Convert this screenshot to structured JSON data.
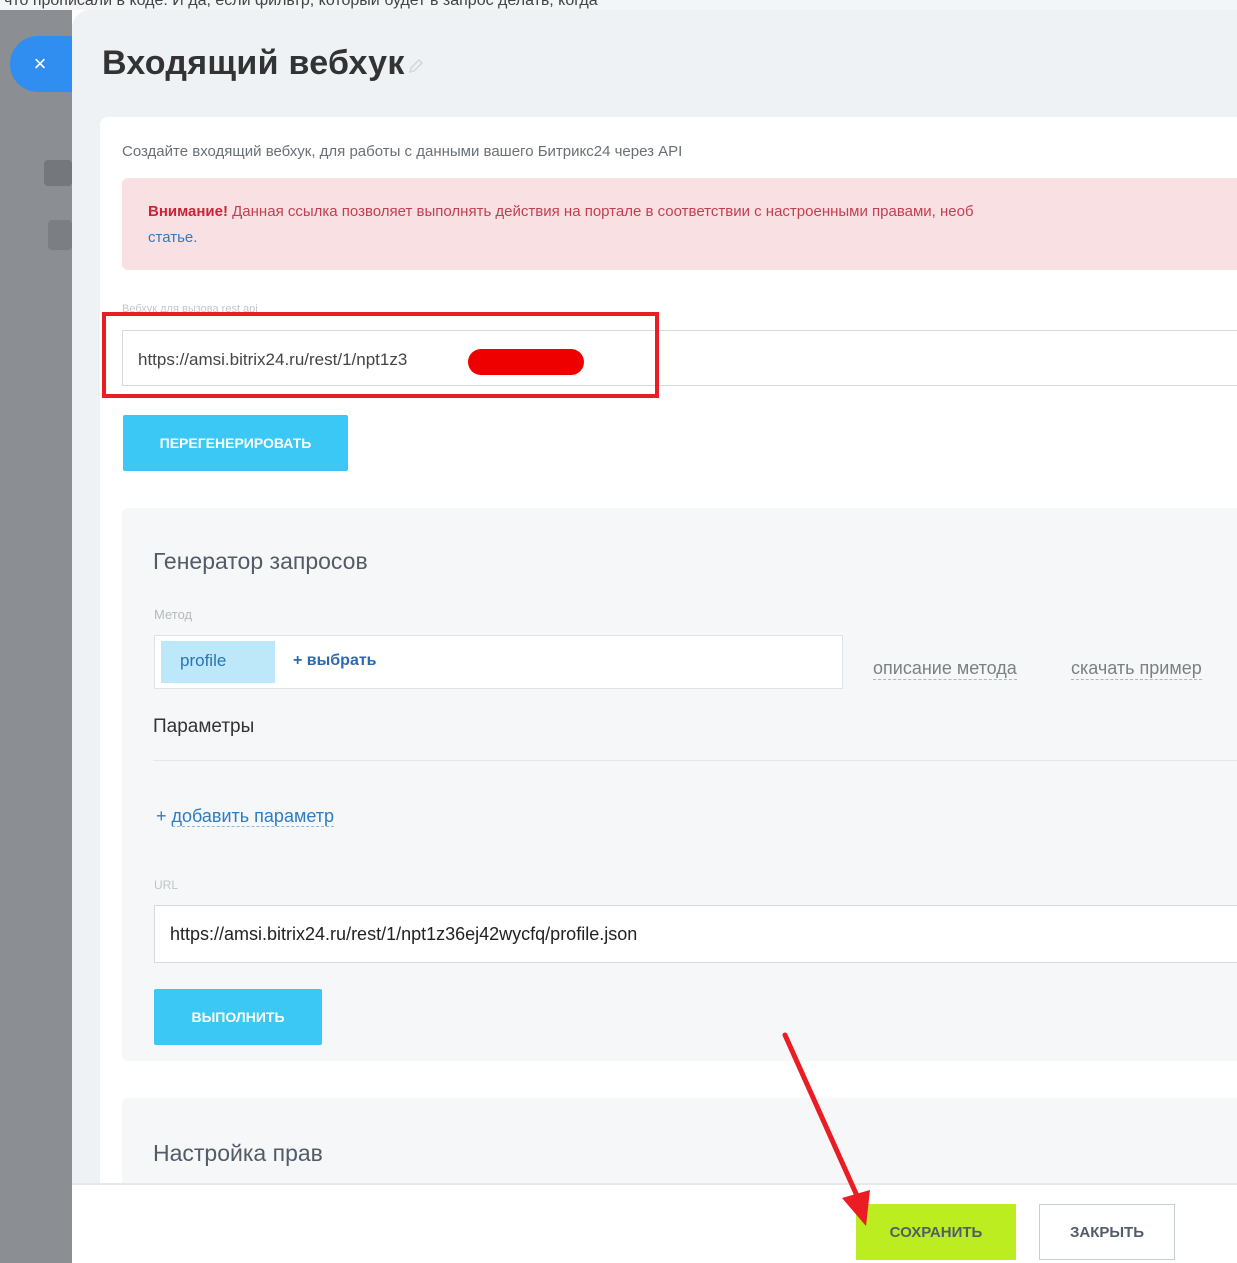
{
  "window": {
    "close_icon": "×",
    "title": "Входящий вебхук",
    "partial_top_text": "что прописали в коде. И да, если фильтр, который будет в запрос делать, когда"
  },
  "intro": {
    "text": "Создайте входящий вебхук, для работы с данными вашего Битрикс24 через API"
  },
  "alert": {
    "strong": "Внимание!",
    "text": " Данная ссылка позволяет выполнять действия на портале в соответствии с настроенными правами, необ",
    "link": "статье."
  },
  "webhook": {
    "label": "Вебхук для вызова rest api",
    "url_visible": "https://amsi.bitrix24.ru/rest/1/npt1z3",
    "regenerate_label": "ПЕРЕГЕНЕРИРОВАТЬ"
  },
  "generator": {
    "title": "Генератор запросов",
    "method_label": "Метод",
    "method_value": "profile",
    "choose_label": "+ выбрать",
    "method_description_link": "описание метода",
    "download_example_link": "скачать пример",
    "params_title": "Параметры",
    "add_param_label": "добавить параметр",
    "url_label": "URL",
    "url_value": "https://amsi.bitrix24.ru/rest/1/npt1z36ej42wycfq/profile.json",
    "run_label": "ВЫПОЛНИТЬ"
  },
  "rights": {
    "title": "Настройка прав"
  },
  "footer": {
    "save_label": "СОХРАНИТЬ",
    "close_label": "ЗАКРЫТЬ"
  },
  "colors": {
    "accent_blue": "#3bc8f5",
    "save_green": "#bbed21",
    "alert_red": "#cc2336",
    "annotation_red": "#ea1c24"
  }
}
